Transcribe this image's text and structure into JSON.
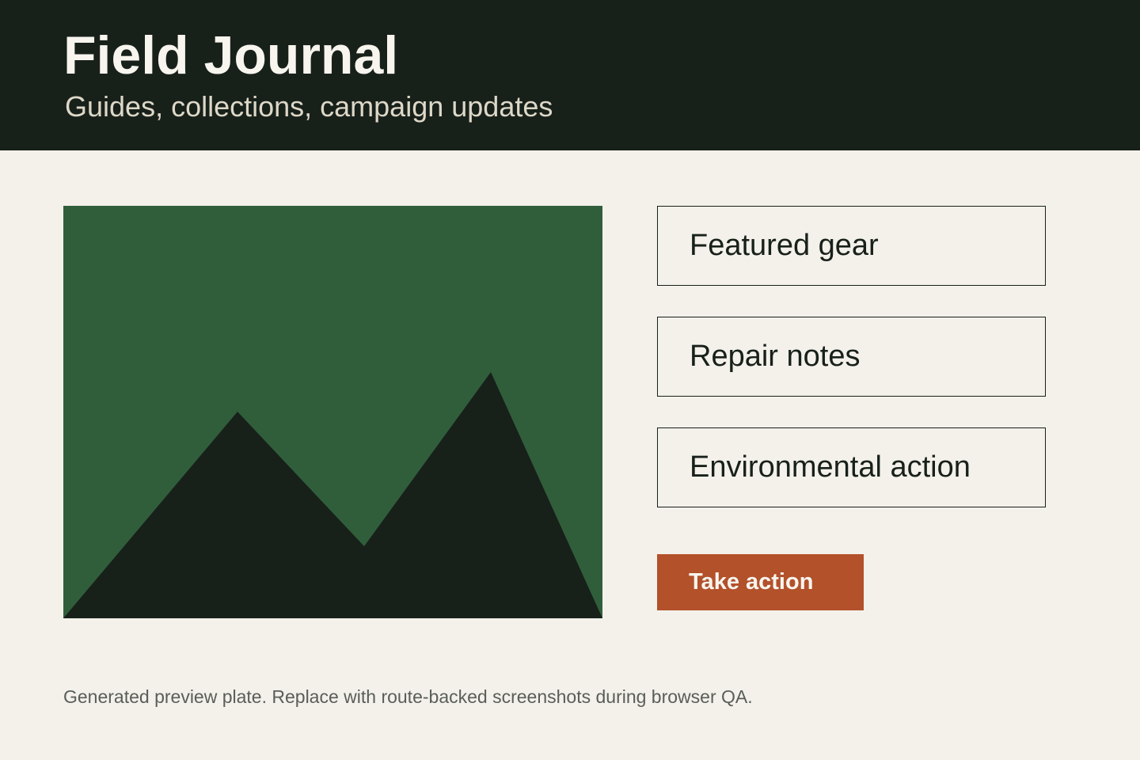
{
  "header": {
    "title": "Field Journal",
    "subtitle": "Guides, collections, campaign updates"
  },
  "hero": {
    "image_name": "mountain-landscape-illustration"
  },
  "nav_cards": [
    {
      "label": "Featured gear"
    },
    {
      "label": "Repair notes"
    },
    {
      "label": "Environmental action"
    }
  ],
  "cta": {
    "label": "Take action"
  },
  "footnote": "Generated preview plate. Replace with route-backed screenshots during browser QA.",
  "colors": {
    "header_background": "#18201a",
    "page_background": "#f3f1ea",
    "hero_background": "#305e3b",
    "mountain": "#18201a",
    "accent": "#b3512b"
  }
}
